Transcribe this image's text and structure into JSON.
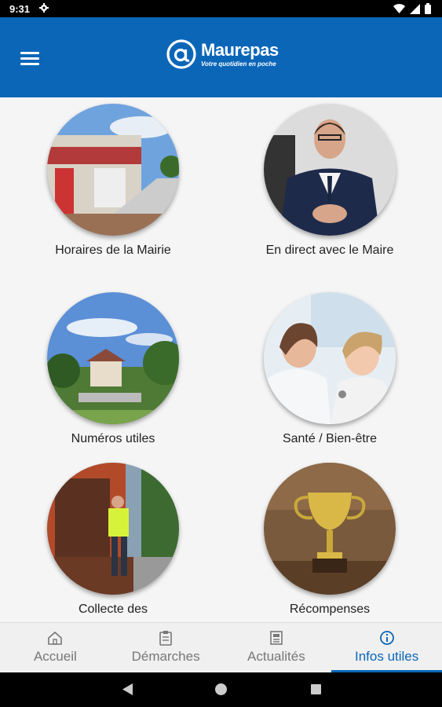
{
  "status_bar": {
    "time": "9:31"
  },
  "app_bar": {
    "logo_name": "Maurepas",
    "logo_tagline": "Votre quotidien en poche"
  },
  "tiles": [
    {
      "label": "Horaires de la Mairie",
      "image": "town-hall-photo"
    },
    {
      "label": "En direct avec le Maire",
      "image": "mayor-portrait-photo"
    },
    {
      "label": "Numéros utiles",
      "image": "town-view-photo"
    },
    {
      "label": "Santé / Bien-être",
      "image": "doctor-child-photo"
    },
    {
      "label": "Collecte des",
      "image": "waste-collection-photo"
    },
    {
      "label": "Récompenses",
      "image": "trophy-photo"
    }
  ],
  "bottom_nav": {
    "items": [
      {
        "label": "Accueil",
        "icon": "home-icon"
      },
      {
        "label": "Démarches",
        "icon": "clipboard-icon"
      },
      {
        "label": "Actualités",
        "icon": "newspaper-icon"
      },
      {
        "label": "Infos utiles",
        "icon": "info-icon",
        "active": true
      }
    ]
  },
  "colors": {
    "primary": "#0b66b8",
    "background": "#f5f5f5"
  }
}
